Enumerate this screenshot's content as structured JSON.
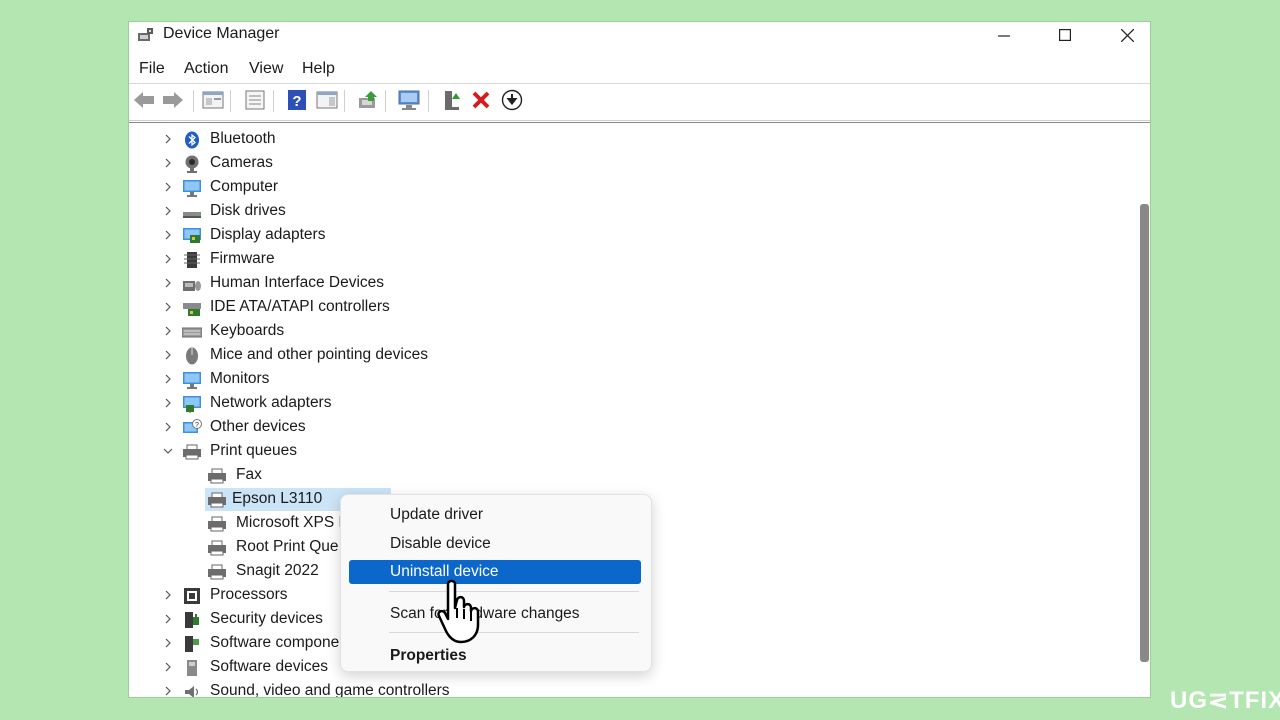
{
  "window": {
    "title": "Device Manager"
  },
  "menu": [
    "File",
    "Action",
    "View",
    "Help"
  ],
  "tree": [
    {
      "label": "Bluetooth",
      "icon": "bluetooth-icon",
      "expanded": false
    },
    {
      "label": "Cameras",
      "icon": "camera-icon",
      "expanded": false
    },
    {
      "label": "Computer",
      "icon": "computer-icon",
      "expanded": false
    },
    {
      "label": "Disk drives",
      "icon": "disk-drive-icon",
      "expanded": false
    },
    {
      "label": "Display adapters",
      "icon": "display-adapter-icon",
      "expanded": false
    },
    {
      "label": "Firmware",
      "icon": "firmware-icon",
      "expanded": false
    },
    {
      "label": "Human Interface Devices",
      "icon": "hid-icon",
      "expanded": false
    },
    {
      "label": "IDE ATA/ATAPI controllers",
      "icon": "ide-controller-icon",
      "expanded": false
    },
    {
      "label": "Keyboards",
      "icon": "keyboard-icon",
      "expanded": false
    },
    {
      "label": "Mice and other pointing devices",
      "icon": "mouse-icon",
      "expanded": false
    },
    {
      "label": "Monitors",
      "icon": "monitor-icon",
      "expanded": false
    },
    {
      "label": "Network adapters",
      "icon": "network-adapter-icon",
      "expanded": false
    },
    {
      "label": "Other devices",
      "icon": "other-devices-icon",
      "expanded": false
    },
    {
      "label": "Print queues",
      "icon": "printer-icon",
      "expanded": true
    },
    {
      "label": "Fax",
      "icon": "printer-icon",
      "child": true
    },
    {
      "label": "Epson L3110",
      "icon": "printer-icon",
      "child": true,
      "selected": true
    },
    {
      "label": "Microsoft XPS D",
      "icon": "printer-icon",
      "child": true
    },
    {
      "label": "Root Print Que",
      "icon": "printer-icon",
      "child": true
    },
    {
      "label": "Snagit 2022",
      "icon": "printer-icon",
      "child": true
    },
    {
      "label": "Processors",
      "icon": "processor-icon",
      "expanded": false
    },
    {
      "label": "Security devices",
      "icon": "security-device-icon",
      "expanded": false
    },
    {
      "label": "Software compone",
      "icon": "software-component-icon",
      "expanded": false
    },
    {
      "label": "Software devices",
      "icon": "software-device-icon",
      "expanded": false
    },
    {
      "label": "Sound, video and game controllers",
      "icon": "sound-icon",
      "expanded": false
    }
  ],
  "context_menu": {
    "update": "Update driver",
    "disable": "Disable device",
    "uninstall": "Uninstall device",
    "scan": "Scan for hardware changes",
    "properties": "Properties"
  },
  "watermark": "UG⋜TFIX",
  "colors": {
    "background": "#b3e6b0",
    "highlight": "#0b67c9",
    "selection": "#cce4f7"
  }
}
